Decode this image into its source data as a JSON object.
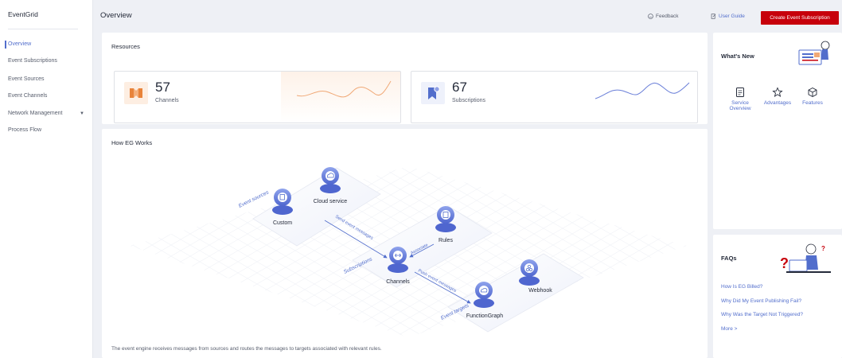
{
  "sidebar": {
    "title": "EventGrid",
    "items": [
      {
        "label": "Overview"
      },
      {
        "label": "Event Subscriptions"
      },
      {
        "label": "Event Sources"
      },
      {
        "label": "Event Channels"
      },
      {
        "label": "Network Management"
      },
      {
        "label": "Process Flow"
      }
    ]
  },
  "header": {
    "title": "Overview",
    "feedback": "Feedback",
    "user_guide": "User Guide",
    "create_button": "Create Event Subscription"
  },
  "resources": {
    "title": "Resources",
    "channels": {
      "count": "57",
      "label": "Channels"
    },
    "subscriptions": {
      "count": "67",
      "label": "Subscriptions"
    }
  },
  "how_it_works": {
    "title": "How EG Works",
    "nodes": {
      "cloud_service": "Cloud service",
      "custom": "Custom",
      "rules": "Rules",
      "channels": "Channels",
      "webhook": "Webhook",
      "function_graph": "FunctionGraph"
    },
    "group_labels": {
      "event_sources": "Event sources",
      "subscriptions": "Subscriptions",
      "event_targets": "Event targets"
    },
    "arrow_labels": {
      "send": "Send event messages",
      "associate": "Associate",
      "push": "Push event messages"
    },
    "caption": "The event engine receives messages from sources and routes the messages to targets associated with relevant rules."
  },
  "whats_new": {
    "title": "What's New",
    "items": [
      {
        "label_line1": "Service",
        "label_line2": "Overview"
      },
      {
        "label_line1": "Advantages",
        "label_line2": ""
      },
      {
        "label_line1": "Features",
        "label_line2": ""
      }
    ]
  },
  "faqs": {
    "title": "FAQs",
    "items": [
      "How Is EG Billed?",
      "Why Did My Event Publishing Fail?",
      "Why Was the Target Not Triggered?",
      "More >"
    ]
  },
  "colors": {
    "accent": "#526ecc",
    "brand_red": "#c7000b",
    "channels_tint": "#fdeee2",
    "subscriptions_tint": "#eef1fb",
    "spark_orange": "#f0a977",
    "spark_blue": "#6a7fd8"
  },
  "icons": {
    "channels": "channels-icon",
    "subscriptions": "bookmark-icon",
    "feedback": "smiley-icon",
    "user_guide": "guide-icon",
    "network_caret": "chevron-down-icon"
  }
}
